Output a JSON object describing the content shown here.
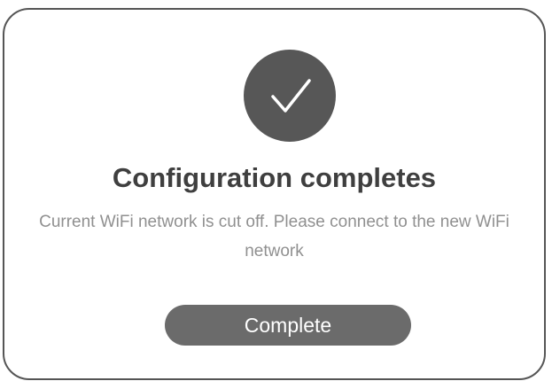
{
  "dialog": {
    "icon": "checkmark-icon",
    "title": "Configuration completes",
    "message": "Current WiFi network is cut off. Please connect to the new WiFi network",
    "complete_label": "Complete"
  },
  "colors": {
    "icon_circle": "#575757",
    "title_text": "#3f3f3f",
    "message_text": "#909090",
    "button_background": "#6b6b6b",
    "button_text": "#ffffff",
    "border": "#555555"
  }
}
